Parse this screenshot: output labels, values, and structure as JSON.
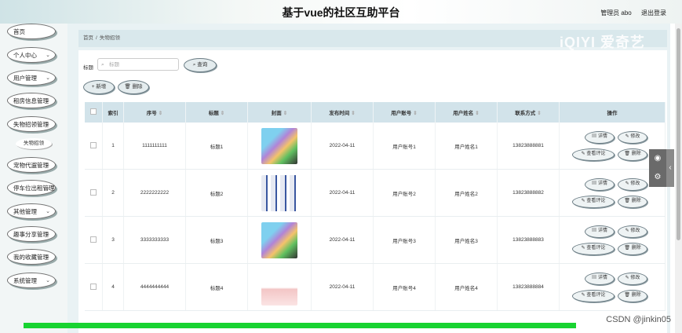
{
  "header": {
    "title": "基于vue的社区互助平台",
    "role": "管理员 abo",
    "logout": "退出登录"
  },
  "sidebar": {
    "items": [
      {
        "label": "首页",
        "chev": false
      },
      {
        "label": "个人中心",
        "chev": true
      },
      {
        "label": "用户管理",
        "chev": true
      },
      {
        "label": "租房信息管理",
        "chev": true
      },
      {
        "label": "失物招领管理",
        "chev": true
      },
      {
        "label": "宠物代遛管理",
        "chev": true
      },
      {
        "label": "停车位出租管理",
        "chev": true
      },
      {
        "label": "其他管理",
        "chev": true
      },
      {
        "label": "趣事分享管理",
        "chev": true
      },
      {
        "label": "我的收藏管理",
        "chev": true
      },
      {
        "label": "系统管理",
        "chev": true
      }
    ],
    "sub_item": "失物招领"
  },
  "breadcrumb": {
    "home": "首页",
    "sep": "/",
    "current": "失物招领"
  },
  "brand_logo": "iQIYI 爱奇艺",
  "search": {
    "label": "标题",
    "placeholder": "标题",
    "button": "查询"
  },
  "toolbar": {
    "add": "新增",
    "delete": "删除"
  },
  "table": {
    "columns": [
      "索引",
      "序号",
      "标题",
      "封面",
      "发布时间",
      "用户账号",
      "用户姓名",
      "联系方式",
      "操作"
    ],
    "rows": [
      {
        "index": "1",
        "serial": "1111111111",
        "title": "标题1",
        "date": "2022-04-11",
        "account": "用户账号1",
        "name": "用户姓名1",
        "phone": "13823888881",
        "cover": "bags"
      },
      {
        "index": "2",
        "serial": "2222222222",
        "title": "标题2",
        "date": "2022-04-11",
        "account": "用户账号2",
        "name": "用户姓名2",
        "phone": "13823888882",
        "cover": "boxes"
      },
      {
        "index": "3",
        "serial": "3333333333",
        "title": "标题3",
        "date": "2022-04-11",
        "account": "用户账号3",
        "name": "用户姓名3",
        "phone": "13823888883",
        "cover": "bags"
      },
      {
        "index": "4",
        "serial": "4444444444",
        "title": "标题4",
        "date": "2022-04-11",
        "account": "用户账号4",
        "name": "用户姓名4",
        "phone": "13823888884",
        "cover": "tissue"
      }
    ],
    "actions": {
      "detail": "详情",
      "edit": "修改",
      "comment": "查看评论",
      "delete": "删除"
    }
  },
  "watermark": "CSDN @jinkin05",
  "colors": {
    "header_bg": "#eef5f3",
    "main_bg": "#e9f2f4",
    "table_head": "#d2e3ea",
    "progress": "#18d331"
  }
}
